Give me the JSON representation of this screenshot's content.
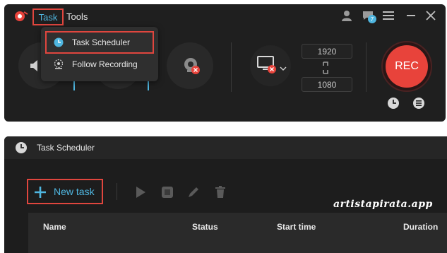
{
  "menu": {
    "task_label": "Task",
    "tools_label": "Tools"
  },
  "dropdown": {
    "items": [
      {
        "label": "Task Scheduler"
      },
      {
        "label": "Follow Recording"
      }
    ]
  },
  "resolution": {
    "width": "1920",
    "height": "1080"
  },
  "record": {
    "label": "REC"
  },
  "notifications": {
    "badge_count": "7"
  },
  "scheduler": {
    "title": "Task Scheduler",
    "new_task_label": "New task",
    "columns": [
      "Name",
      "Status",
      "Start time",
      "Duration"
    ]
  },
  "watermark": "artistapirata.app",
  "colors": {
    "accent_red": "#e8433b",
    "highlight_border": "#e0463e",
    "accent_blue": "#4fb6e0"
  },
  "icons": [
    "app-logo-icon",
    "user-icon",
    "chat-icon",
    "menu-icon",
    "minimize-icon",
    "close-icon",
    "speaker-icon",
    "webcam-icon",
    "monitor-icon",
    "link-icon",
    "clock-icon",
    "list-icon",
    "plus-icon",
    "play-icon",
    "stop-icon",
    "edit-icon",
    "trash-icon"
  ]
}
